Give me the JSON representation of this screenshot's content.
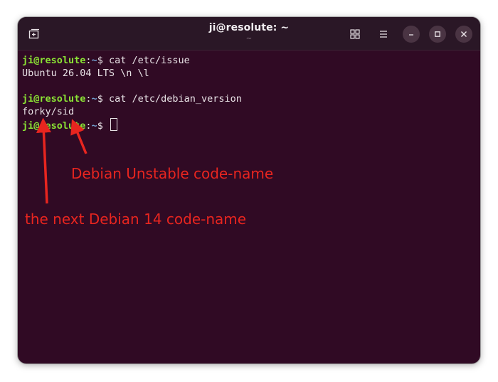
{
  "window": {
    "title": "ji@resolute: ~",
    "subtitle": "~"
  },
  "icons": {
    "new_tab": "new-tab-icon",
    "grid": "grid-view-icon",
    "menu": "hamburger-menu-icon",
    "minimize": "minimize-icon",
    "maximize": "maximize-icon",
    "close": "close-icon"
  },
  "colors": {
    "terminal_bg": "#300a24",
    "prompt_user": "#8ae234",
    "prompt_path": "#729fcf",
    "annotation": "#e8251f"
  },
  "terminal": {
    "prompt_user": "ji@resolute",
    "prompt_sep": ":",
    "prompt_path": "~",
    "prompt_symbol": "$ ",
    "lines": [
      {
        "type": "prompt",
        "command": "cat /etc/issue"
      },
      {
        "type": "output",
        "text": "Ubuntu 26.04 LTS \\n \\l"
      },
      {
        "type": "blank",
        "text": ""
      },
      {
        "type": "prompt",
        "command": "cat /etc/debian_version"
      },
      {
        "type": "output",
        "text": "forky/sid"
      },
      {
        "type": "prompt",
        "command": ""
      }
    ]
  },
  "annotations": {
    "unstable": "Debian Unstable code-name",
    "next": "the next Debian 14 code-name"
  }
}
